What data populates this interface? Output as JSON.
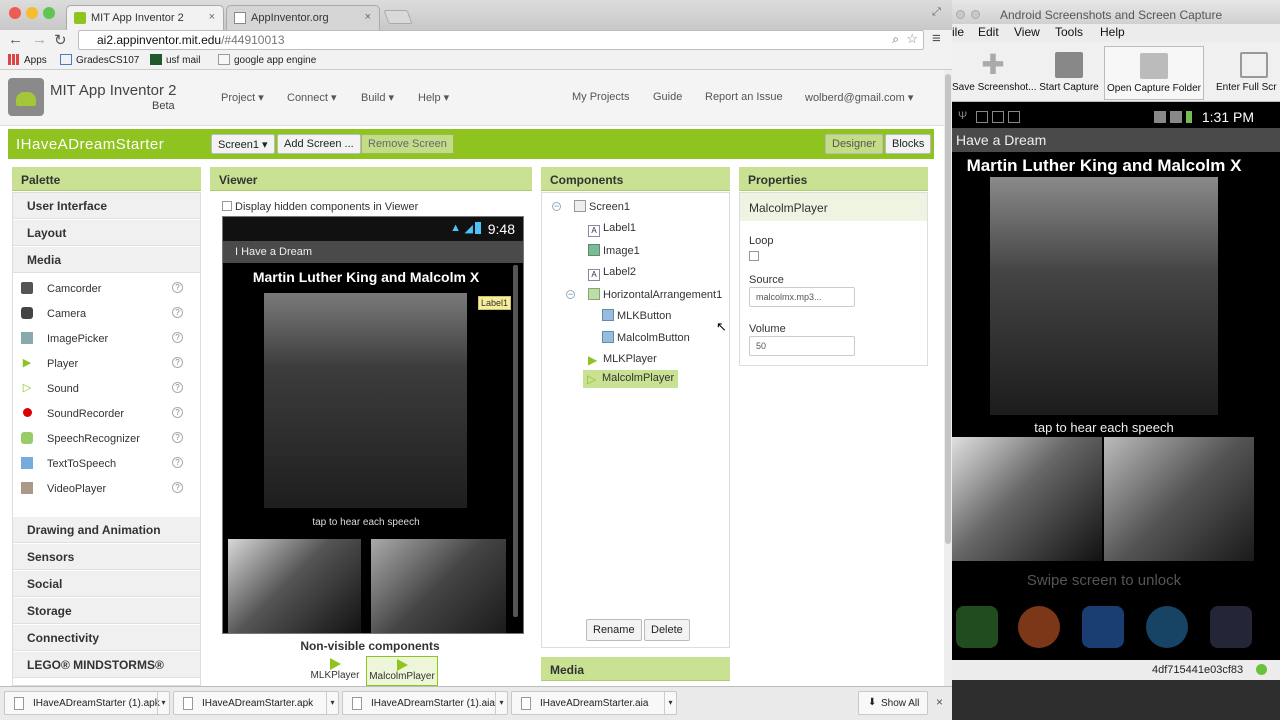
{
  "browser": {
    "tabs": [
      {
        "label": "MIT App Inventor 2",
        "close": "×"
      },
      {
        "label": "AppInventor.org",
        "close": "×"
      }
    ],
    "url_host": "ai2.appinventor.mit.edu",
    "url_path": "/#44910013",
    "bookmarks": [
      "Apps",
      "GradesCS107",
      "usf mail",
      "google app engine"
    ]
  },
  "appinventor": {
    "title": "MIT App Inventor 2",
    "beta": "Beta",
    "menus": [
      "Project ▾",
      "Connect ▾",
      "Build ▾",
      "Help ▾"
    ],
    "right_links": [
      "My Projects",
      "Guide",
      "Report an Issue",
      "wolberd@gmail.com ▾"
    ],
    "project_name": "IHaveADreamStarter",
    "screen_select": "Screen1 ▾",
    "add_screen": "Add Screen ...",
    "remove_screen": "Remove Screen",
    "designer": "Designer",
    "blocks": "Blocks"
  },
  "palette": {
    "header": "Palette",
    "categories_top": [
      "User Interface",
      "Layout",
      "Media"
    ],
    "media_items": [
      {
        "label": "Camcorder",
        "icon": "camcorder-icon"
      },
      {
        "label": "Camera",
        "icon": "camera-icon"
      },
      {
        "label": "ImagePicker",
        "icon": "image-picker-icon"
      },
      {
        "label": "Player",
        "icon": "player-icon"
      },
      {
        "label": "Sound",
        "icon": "sound-icon"
      },
      {
        "label": "SoundRecorder",
        "icon": "sound-recorder-icon"
      },
      {
        "label": "SpeechRecognizer",
        "icon": "speech-recognizer-icon"
      },
      {
        "label": "TextToSpeech",
        "icon": "text-to-speech-icon"
      },
      {
        "label": "VideoPlayer",
        "icon": "video-player-icon"
      }
    ],
    "help_glyph": "?",
    "categories_bottom": [
      "Drawing and Animation",
      "Sensors",
      "Social",
      "Storage",
      "Connectivity",
      "LEGO® MINDSTORMS®"
    ]
  },
  "viewer": {
    "header": "Viewer",
    "hidden_checkbox_label": "Display hidden components in Viewer",
    "phone_time": "9:48",
    "app_title": "I Have a Dream",
    "heading": "Martin Luther King and Malcolm X",
    "label_tag": "Label1",
    "caption": "tap to hear each speech",
    "nonvisible_label": "Non-visible components",
    "nonvisible": [
      "MLKPlayer",
      "MalcolmPlayer"
    ]
  },
  "components": {
    "header": "Components",
    "tree": [
      "Screen1",
      "Label1",
      "Image1",
      "Label2",
      "HorizontalArrangement1",
      "MLKButton",
      "MalcolmButton",
      "MLKPlayer",
      "MalcolmPlayer"
    ],
    "selected": "MalcolmPlayer",
    "rename": "Rename",
    "delete": "Delete",
    "media_header": "Media"
  },
  "properties": {
    "header": "Properties",
    "component": "MalcolmPlayer",
    "loop_label": "Loop",
    "source_label": "Source",
    "source_value": "malcolmx.mp3...",
    "volume_label": "Volume",
    "volume_value": "50"
  },
  "downloads": {
    "items": [
      "IHaveADreamStarter (1).apk",
      "IHaveADreamStarter.apk",
      "IHaveADreamStarter (1).aia",
      "IHaveADreamStarter.aia"
    ],
    "show_all": "Show All",
    "close": "×"
  },
  "screencap": {
    "title": "Android Screenshots and Screen Capture",
    "menu": [
      "ile",
      "Edit",
      "View",
      "Tools",
      "Help"
    ],
    "toolbar": [
      "Save Screenshot...",
      "Start Capture",
      "Open Capture Folder",
      "Enter Full Scr"
    ],
    "device_time": "1:31 PM",
    "device_title": "Have a Dream",
    "device_heading": "Martin Luther King and Malcolm X",
    "device_caption": "tap to hear each speech",
    "swipe": "Swipe screen to unlock",
    "serial": "4df715441e03cf83"
  },
  "colors": {
    "accent_green": "#8fc31f",
    "panel_header": "#c9e192"
  }
}
